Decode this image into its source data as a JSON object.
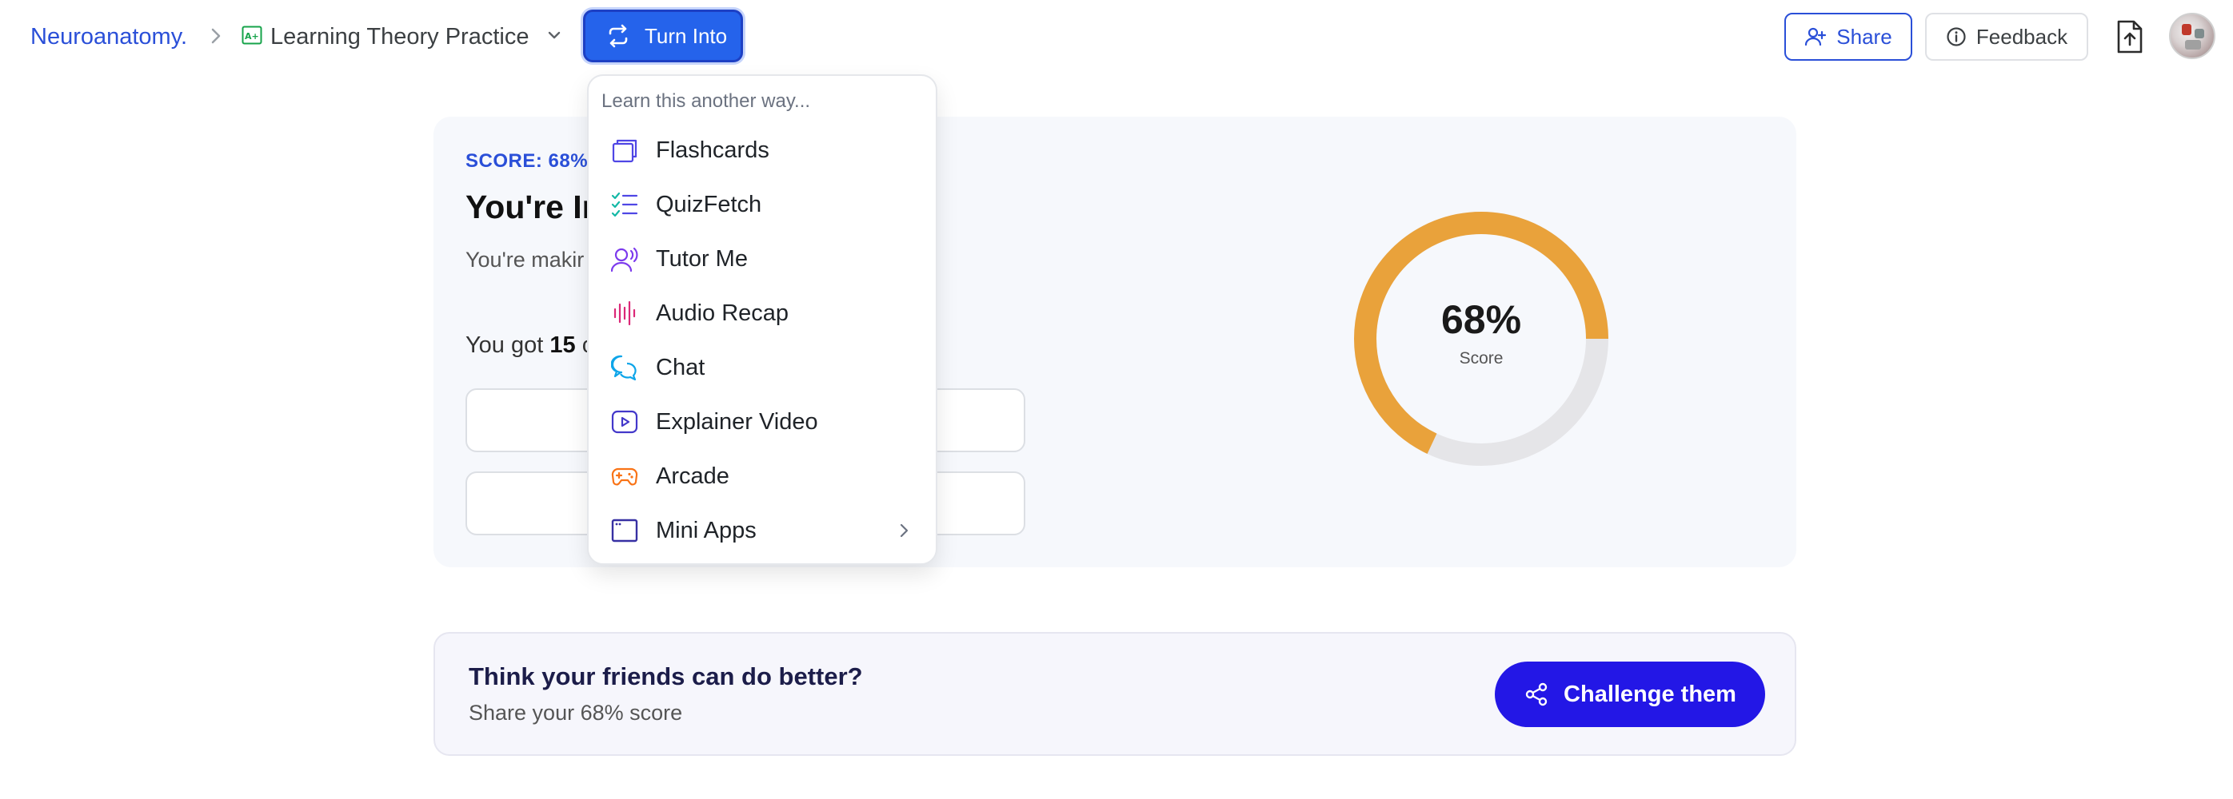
{
  "header": {
    "breadcrumb_root": "Neuroanatomy.",
    "doc_title": "Learning Theory Practice",
    "turn_into_label": "Turn Into",
    "share_label": "Share",
    "feedback_label": "Feedback"
  },
  "dropdown": {
    "hint": "Learn this another way...",
    "items": [
      {
        "label": "Flashcards",
        "icon": "flashcards-icon",
        "color": "#4f46e5"
      },
      {
        "label": "QuizFetch",
        "icon": "checklist-icon",
        "color": "#14b8a6"
      },
      {
        "label": "Tutor Me",
        "icon": "tutor-voice-icon",
        "color": "#7c3aed"
      },
      {
        "label": "Audio Recap",
        "icon": "audio-wave-icon",
        "color": "#db2777"
      },
      {
        "label": "Chat",
        "icon": "chat-bubbles-icon",
        "color": "#0ea5e9"
      },
      {
        "label": "Explainer Video",
        "icon": "play-video-icon",
        "color": "#4338ca"
      },
      {
        "label": "Arcade",
        "icon": "gamepad-icon",
        "color": "#f97316"
      },
      {
        "label": "Mini Apps",
        "icon": "app-window-icon",
        "color": "#3730a3"
      }
    ]
  },
  "score": {
    "label": "SCORE: 68%",
    "heading": "You're In",
    "description": "You're makir                                    d try again to imp",
    "got_prefix": "You got",
    "got_number": "15",
    "got_suffix": "c",
    "percent_text": "68%",
    "percent_value": 0.68,
    "ring_sublabel": "Score",
    "ring_color": "#e9a23b",
    "track_color": "#e5e5e8"
  },
  "challenge": {
    "title": "Think your friends can do better?",
    "subtitle": "Share your 68% score",
    "button_label": "Challenge them"
  }
}
